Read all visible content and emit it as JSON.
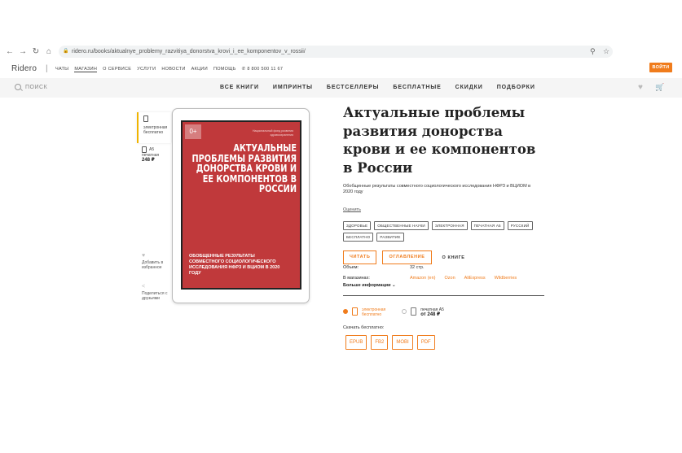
{
  "browser": {
    "url": "ridero.ru/books/aktualnye_problemy_razvitiya_donorstva_krovi_i_ee_komponentov_v_rossii/"
  },
  "header": {
    "logo": "Ridero",
    "links": [
      "ЧАТЫ",
      "МАГАЗИН",
      "О СЕРВИСЕ",
      "УСЛУГИ",
      "НОВОСТИ",
      "АКЦИИ",
      "ПОМОЩЬ"
    ],
    "active_link_index": 1,
    "phone": "8 800 500 11 67",
    "login": "ВОЙТИ"
  },
  "nav": {
    "search_label": "ПОИСК",
    "items": [
      "ВСЕ КНИГИ",
      "ИМПРИНТЫ",
      "БЕСТСЕЛЛЕРЫ",
      "БЕСПЛАТНЫЕ",
      "СКИДКИ",
      "ПОДБОРКИ"
    ]
  },
  "formats_side": [
    {
      "type": "электронная",
      "price": "бесплатно",
      "active": true
    },
    {
      "type": "A5",
      "sub": "печатная",
      "price": "248 ₽",
      "active": false
    }
  ],
  "side_actions": {
    "favorite": "Добавить в избранное",
    "share": "Поделиться с друзьями"
  },
  "cover": {
    "age": "0+",
    "org": "Национальный фонд развития здравоохранения",
    "title": "АКТУАЛЬНЫЕ ПРОБЛЕМЫ РАЗВИТИЯ ДОНОРСТВА КРОВИ И ЕЕ КОМПОНЕНТОВ В РОССИИ",
    "subtitle": "Обобщенные результаты совместного социологического исследования НФРЗ и ВЦИОМ в 2020 году"
  },
  "book": {
    "title": "Актуальные проблемы развития донорства крови и ее компонентов в России",
    "subtitle": "Обобщенные результаты совместного социологического исследования НФРЗ и ВЦИОМ в 2020 году",
    "rate_label": "Оценить",
    "tags": [
      "ЗДОРОВЬЕ",
      "ОБЩЕСТВЕННЫЕ НАУКИ",
      "ЭЛЕКТРОННАЯ",
      "ПЕЧАТНАЯ A5",
      "РУССКИЙ",
      "БЕСПЛАТНО",
      "РАЗВИТИЕ"
    ],
    "read_btn": "ЧИТАТЬ",
    "toc_btn": "ОГЛАВЛЕНИЕ",
    "about_link": "О КНИГЕ"
  },
  "meta": {
    "volume_label": "Объем:",
    "volume_value": "32 стр.",
    "shops_label": "В магазинах:",
    "shops": [
      "Amazon (en)",
      "Ozon",
      "AliExpress",
      "Wildberries"
    ],
    "more_info": "Больше информации ⌄"
  },
  "format_select": [
    {
      "type": "электронная",
      "price": "бесплатно",
      "selected": true
    },
    {
      "type": "печатная A5",
      "price": "от 248 ₽",
      "selected": false
    }
  ],
  "download": {
    "label": "Скачать бесплатно:",
    "formats": [
      "EPUB",
      "FB2",
      "MOBI",
      "PDF"
    ]
  }
}
